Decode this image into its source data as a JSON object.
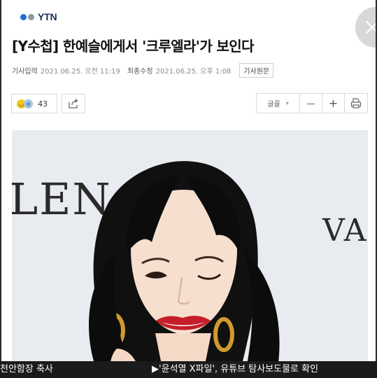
{
  "brand": {
    "logo_text": "YTN",
    "dot_colors": [
      "#1f6fd1",
      "#7a8a9a"
    ]
  },
  "article": {
    "title": "[Y수첩] 한예슬에게서 '크루엘라'가 보인다",
    "published_label": "기사입력",
    "published_value": "2021.06.25. 오전 11:19",
    "modified_label": "최종수정",
    "modified_value": "2021.06.25. 오후 1:08",
    "original_button": "기사원문"
  },
  "actions": {
    "reaction_count": "43",
    "font_label": "글꼴",
    "font_arrow": "▾",
    "zoom_out": "—",
    "zoom_in": "+",
    "print_icon": "print-icon"
  },
  "photo": {
    "backdrop_left": "LEN",
    "backdrop_right": "VA"
  },
  "ticker": {
    "left_text": "천안함장 축사",
    "right_text": "▶'윤석열 X파일', 유튜브 탐사보도물로 확인"
  },
  "colors": {
    "navy": "#1b2d57",
    "lip": "#c41e2a",
    "hair": "#111111"
  }
}
